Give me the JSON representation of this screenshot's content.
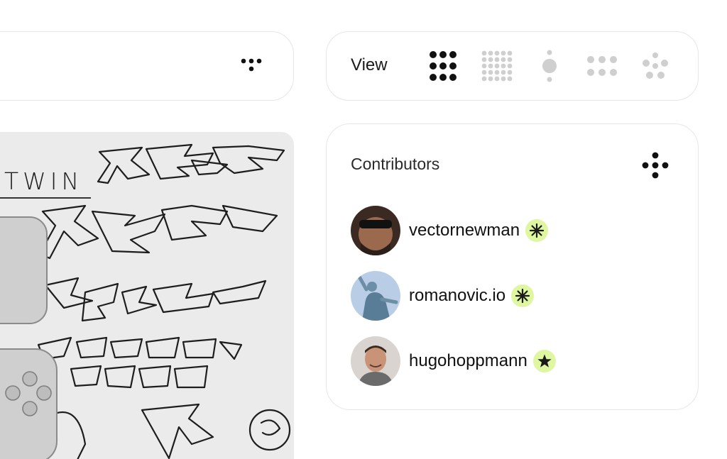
{
  "left_toolbar": {
    "more_icon": "more-dots-icon"
  },
  "artwork": {
    "title": "TWIN"
  },
  "view_bar": {
    "label": "View",
    "options": [
      {
        "icon": "grid-large-icon",
        "selected": true
      },
      {
        "icon": "grid-small-icon",
        "selected": false
      },
      {
        "icon": "single-focus-icon",
        "selected": false
      },
      {
        "icon": "grid-medium-icon",
        "selected": false
      },
      {
        "icon": "cluster-icon",
        "selected": false
      }
    ]
  },
  "contributors": {
    "title": "Contributors",
    "more_icon": "more-dots-icon",
    "badge_color": "#dff7a0",
    "items": [
      {
        "name": "vectornewman",
        "badge_icon": "asterisk-icon"
      },
      {
        "name": "romanovic.io",
        "badge_icon": "asterisk-icon"
      },
      {
        "name": "hugohoppmann",
        "badge_icon": "star-icon"
      }
    ]
  }
}
